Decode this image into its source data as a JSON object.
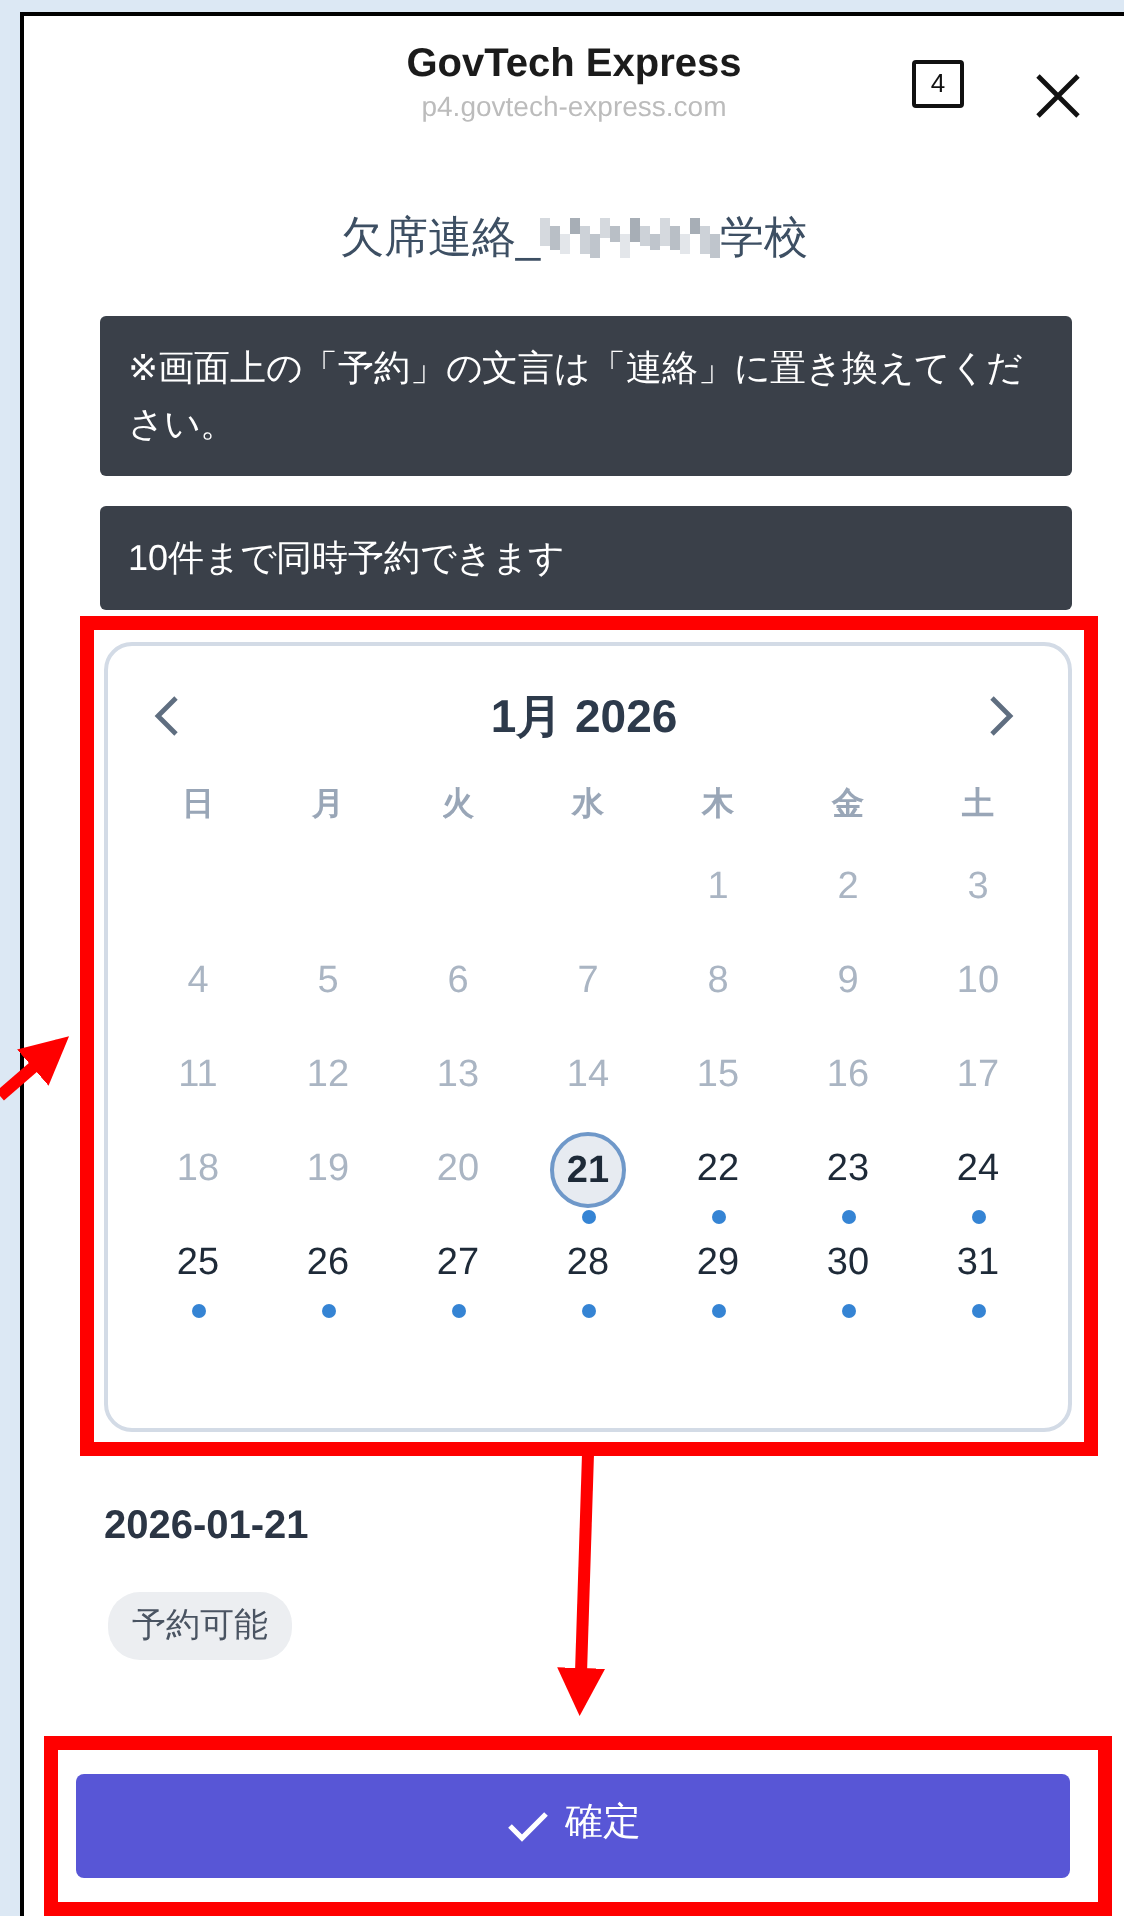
{
  "browser_header": {
    "title": "GovTech Express",
    "url": "p4.govtech-express.com",
    "tab_count": "4"
  },
  "page_title": {
    "prefix": "欠席連絡_",
    "suffix": "学校",
    "redacted": true
  },
  "notices": [
    "※画面上の「予約」の文言は「連絡」に置き換えてください。",
    "10件まで同時予約できます"
  ],
  "calendar": {
    "month_label": "1月 2026",
    "weekdays": [
      "日",
      "月",
      "火",
      "水",
      "木",
      "金",
      "土"
    ],
    "weeks": [
      [
        {
          "label": "1",
          "available": false,
          "selected": false
        },
        {
          "label": "2",
          "available": false,
          "selected": false
        },
        {
          "label": "3",
          "available": false,
          "selected": false
        }
      ],
      [
        {
          "label": "4",
          "available": false,
          "selected": false
        },
        {
          "label": "5",
          "available": false,
          "selected": false
        },
        {
          "label": "6",
          "available": false,
          "selected": false
        },
        {
          "label": "7",
          "available": false,
          "selected": false
        },
        {
          "label": "8",
          "available": false,
          "selected": false
        },
        {
          "label": "9",
          "available": false,
          "selected": false
        },
        {
          "label": "10",
          "available": false,
          "selected": false
        }
      ],
      [
        {
          "label": "11",
          "available": false,
          "selected": false
        },
        {
          "label": "12",
          "available": false,
          "selected": false
        },
        {
          "label": "13",
          "available": false,
          "selected": false
        },
        {
          "label": "14",
          "available": false,
          "selected": false
        },
        {
          "label": "15",
          "available": false,
          "selected": false
        },
        {
          "label": "16",
          "available": false,
          "selected": false
        },
        {
          "label": "17",
          "available": false,
          "selected": false
        }
      ],
      [
        {
          "label": "18",
          "available": false,
          "selected": false
        },
        {
          "label": "19",
          "available": false,
          "selected": false
        },
        {
          "label": "20",
          "available": false,
          "selected": false
        },
        {
          "label": "21",
          "available": true,
          "selected": true
        },
        {
          "label": "22",
          "available": true,
          "selected": false
        },
        {
          "label": "23",
          "available": true,
          "selected": false
        },
        {
          "label": "24",
          "available": true,
          "selected": false
        }
      ],
      [
        {
          "label": "25",
          "available": true,
          "selected": false
        },
        {
          "label": "26",
          "available": true,
          "selected": false
        },
        {
          "label": "27",
          "available": true,
          "selected": false
        },
        {
          "label": "28",
          "available": true,
          "selected": false
        },
        {
          "label": "29",
          "available": true,
          "selected": false
        },
        {
          "label": "30",
          "available": true,
          "selected": false
        },
        {
          "label": "31",
          "available": true,
          "selected": false
        }
      ]
    ]
  },
  "selected_date": "2026-01-21",
  "status_badge": "予約可能",
  "confirm_button": "確定"
}
